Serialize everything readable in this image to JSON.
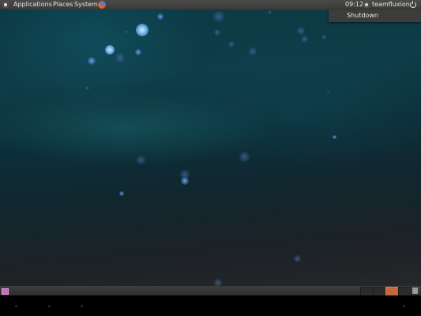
{
  "top_panel": {
    "menus": [
      "Applications",
      "Places",
      "System"
    ],
    "clock": "09:12",
    "username": "teamfluxion"
  },
  "shutdown_menu": {
    "item": "Shutdown"
  },
  "bottom_panel": {
    "workspace_count": 4,
    "active_workspace": 3
  },
  "colors": {
    "panel": "#3c3c3a",
    "active_workspace": "#c4693b",
    "wallpaper": "#0e3d48"
  },
  "icons": [
    "ubuntu-logo-icon",
    "firefox-icon",
    "user-icon",
    "power-icon",
    "show-desktop-icon",
    "trash-icon"
  ]
}
